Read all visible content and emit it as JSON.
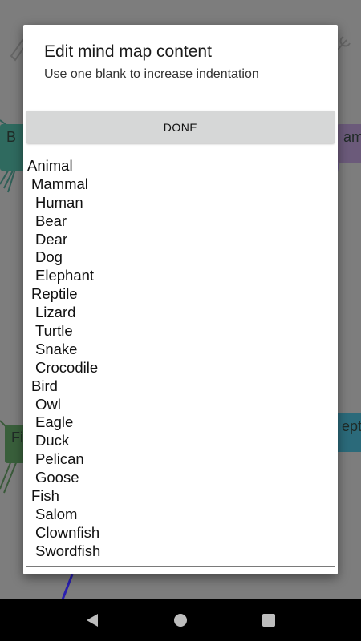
{
  "background": {
    "nodes": [
      "B",
      "amm",
      "Fi",
      "eptil"
    ]
  },
  "dialog": {
    "title": "Edit mind map content",
    "subtitle": "Use one blank to increase indentation",
    "done_label": "DONE",
    "lines": [
      {
        "text": "Animal",
        "level": 0
      },
      {
        "text": "Mammal",
        "level": 1
      },
      {
        "text": "Human",
        "level": 2
      },
      {
        "text": "Bear",
        "level": 2
      },
      {
        "text": "Dear",
        "level": 2
      },
      {
        "text": "Dog",
        "level": 2
      },
      {
        "text": "Elephant",
        "level": 2
      },
      {
        "text": "Reptile",
        "level": 1
      },
      {
        "text": "Lizard",
        "level": 2
      },
      {
        "text": "Turtle",
        "level": 2
      },
      {
        "text": "Snake",
        "level": 2
      },
      {
        "text": "Crocodile",
        "level": 2
      },
      {
        "text": "Bird",
        "level": 1
      },
      {
        "text": "Owl",
        "level": 2
      },
      {
        "text": "Eagle",
        "level": 2
      },
      {
        "text": "Duck",
        "level": 2
      },
      {
        "text": "Pelican",
        "level": 2
      },
      {
        "text": "Goose",
        "level": 2
      },
      {
        "text": "Fish",
        "level": 1
      },
      {
        "text": "Salom",
        "level": 2
      },
      {
        "text": "Clownfish",
        "level": 2
      },
      {
        "text": "Swordfish",
        "level": 2
      }
    ]
  },
  "navbar": {
    "back_icon": "back-triangle-icon",
    "home_icon": "home-circle-icon",
    "recents_icon": "recents-square-icon"
  }
}
